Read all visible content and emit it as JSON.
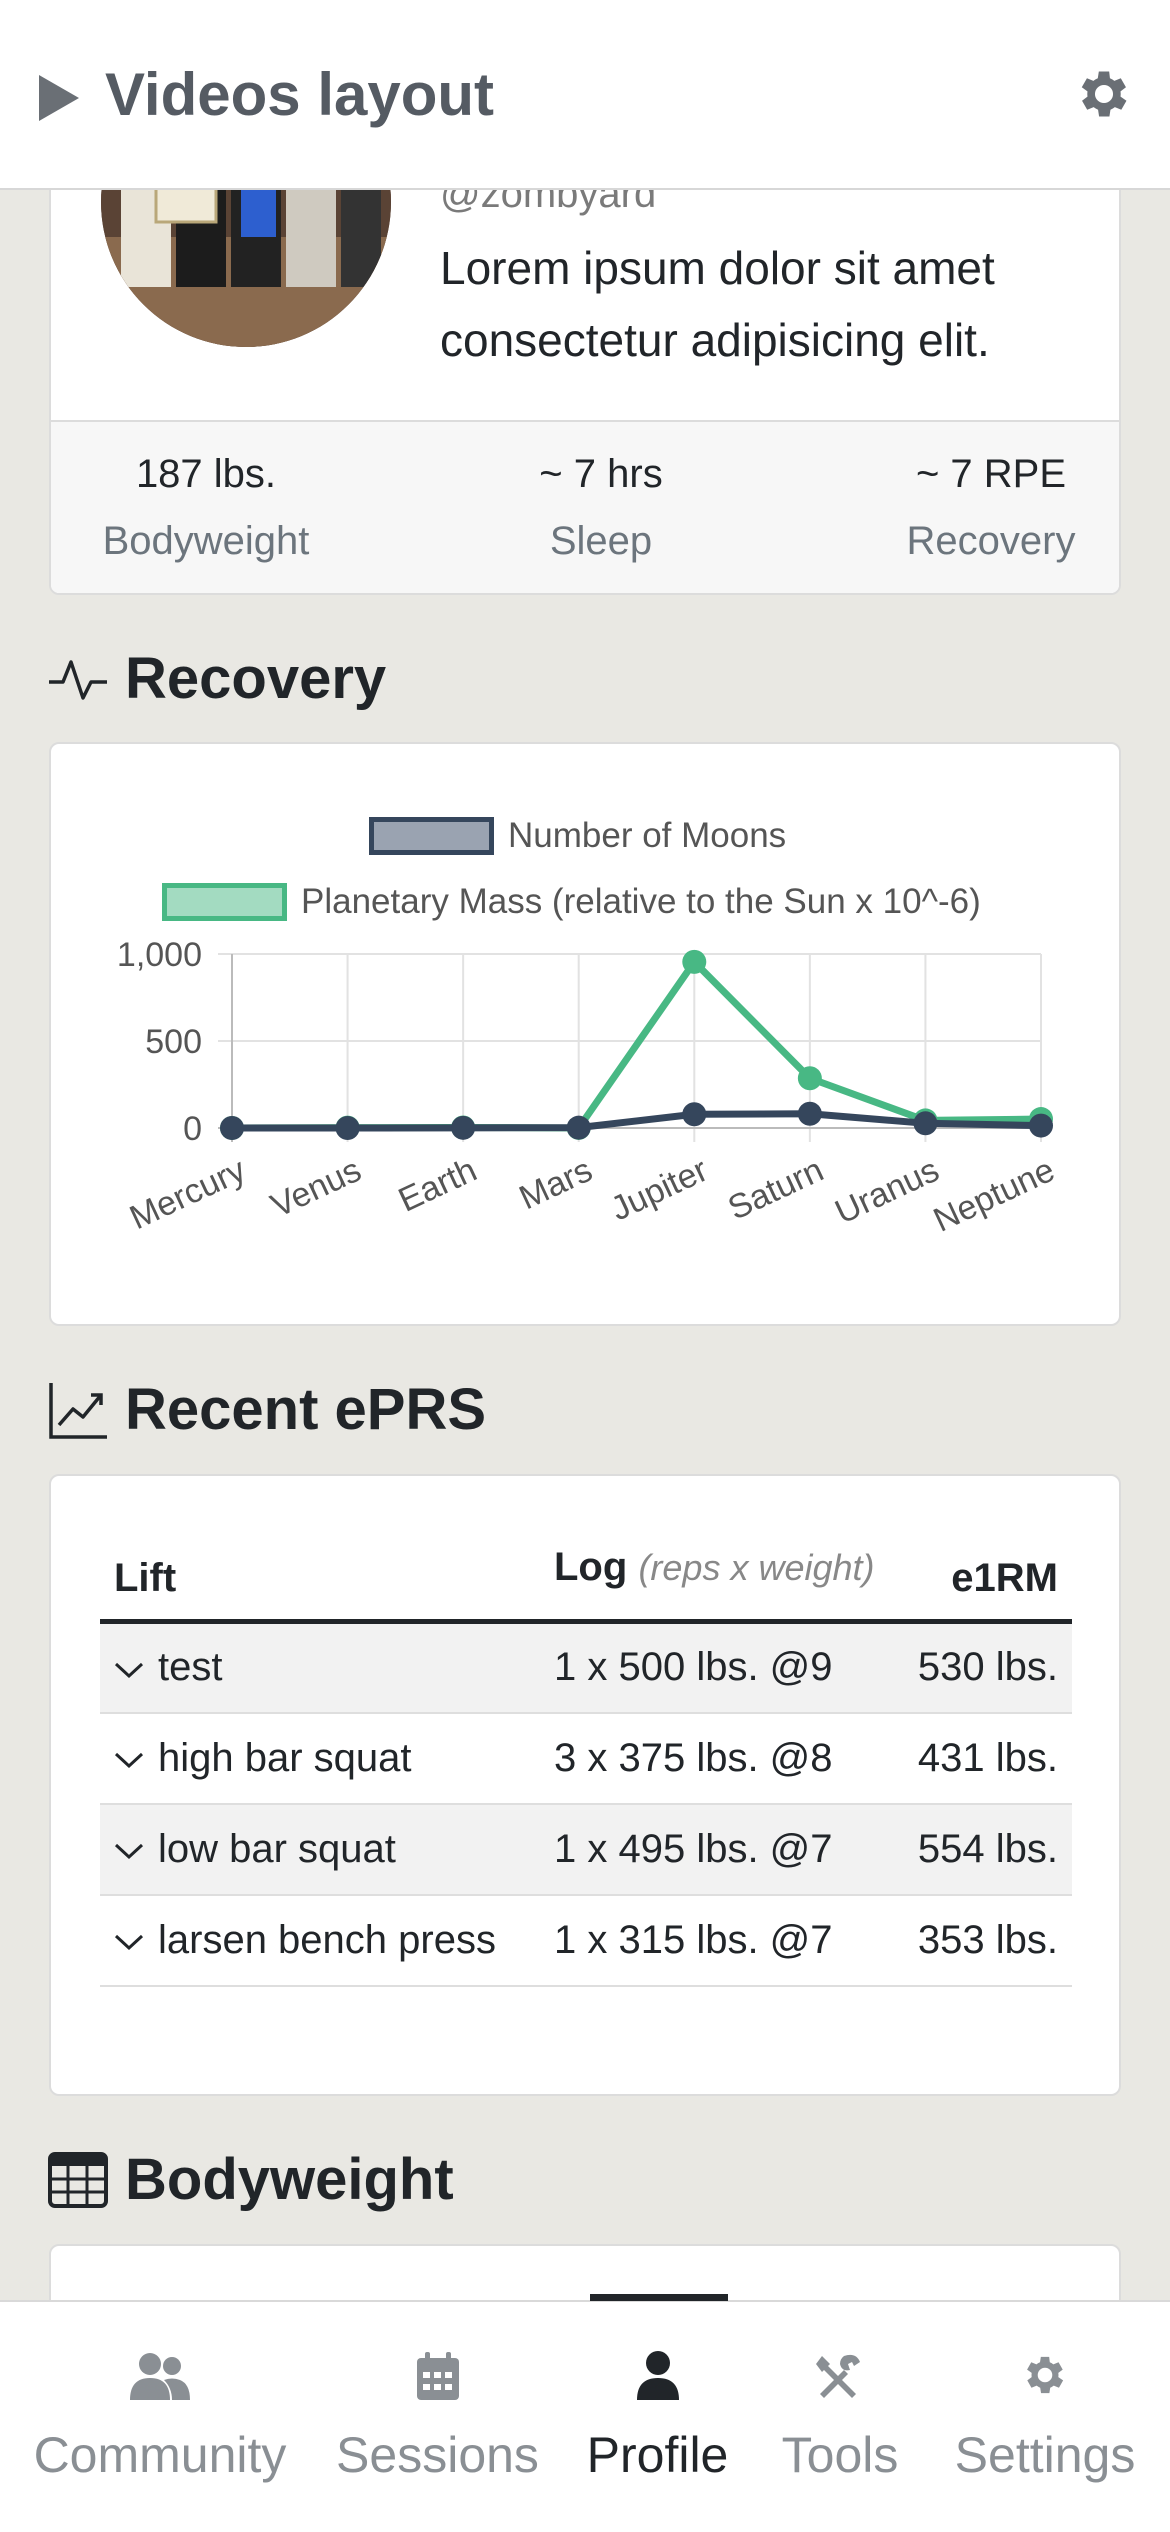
{
  "header": {
    "title": "Videos layout",
    "play_icon": "play-icon",
    "settings_icon": "gear-icon"
  },
  "profile": {
    "handle": "@zombyard",
    "bio": "Lorem ipsum dolor sit amet consectetur adipisicing elit.",
    "stats": [
      {
        "value": "187 lbs.",
        "label": "Bodyweight"
      },
      {
        "value": "~ 7 hrs",
        "label": "Sleep"
      },
      {
        "value": "~ 7 RPE",
        "label": "Recovery"
      }
    ]
  },
  "recovery": {
    "title": "Recovery",
    "chart_data": {
      "type": "line",
      "categories": [
        "Mercury",
        "Venus",
        "Earth",
        "Mars",
        "Jupiter",
        "Saturn",
        "Uranus",
        "Neptune"
      ],
      "series": [
        {
          "name": "Number of Moons",
          "values": [
            0,
            0,
            1,
            2,
            79,
            82,
            27,
            14
          ],
          "color": "#35465c",
          "fill": "#9aa3b1"
        },
        {
          "name": "Planetary Mass (relative to the Sun x 10^-6)",
          "values": [
            0.166,
            2.081,
            3.003,
            0.323,
            954.792,
            285.886,
            43.662,
            51.514
          ],
          "color": "#48b884",
          "fill": "#a3dbc1"
        }
      ],
      "yticks": [
        "1,000",
        "500",
        "0"
      ],
      "ylim": [
        0,
        1000
      ],
      "grid": true,
      "legend": "top"
    }
  },
  "eprs": {
    "title": "Recent ePRS",
    "columns": {
      "lift": "Lift",
      "log": "Log",
      "log_sub": "(reps x weight)",
      "e1rm": "e1RM"
    },
    "rows": [
      {
        "lift": "test",
        "log": "1 x 500 lbs. @9",
        "e1rm": "530 lbs."
      },
      {
        "lift": "high bar squat",
        "log": "3 x 375 lbs. @8",
        "e1rm": "431 lbs."
      },
      {
        "lift": "low bar squat",
        "log": "1 x 495 lbs. @7",
        "e1rm": "554 lbs."
      },
      {
        "lift": "larsen bench press",
        "log": "1 x 315 lbs. @7",
        "e1rm": "353 lbs."
      }
    ]
  },
  "bodyweight": {
    "title": "Bodyweight"
  },
  "nav": [
    {
      "label": "Community",
      "icon": "users-icon"
    },
    {
      "label": "Sessions",
      "icon": "calendar-icon"
    },
    {
      "label": "Profile",
      "icon": "user-icon",
      "active": true
    },
    {
      "label": "Tools",
      "icon": "tools-icon"
    },
    {
      "label": "Settings",
      "icon": "gear-icon"
    }
  ]
}
